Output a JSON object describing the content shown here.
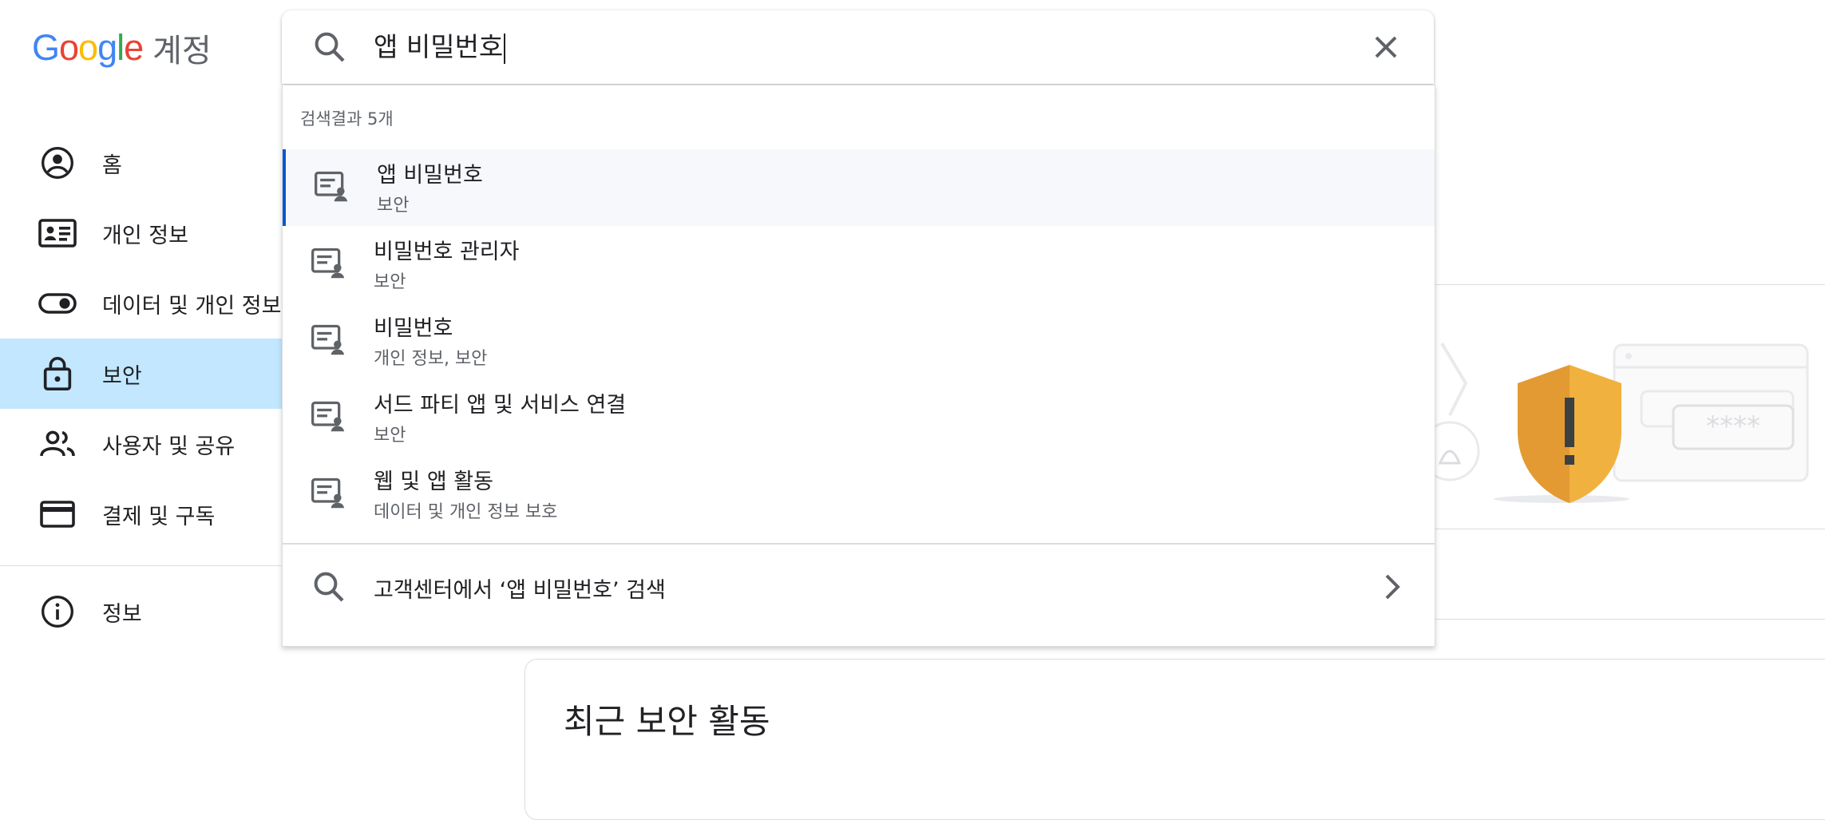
{
  "header": {
    "logo_text": "Google",
    "product_name": "계정"
  },
  "sidebar": {
    "items": [
      {
        "label": "홈",
        "icon": "account-circle-icon"
      },
      {
        "label": "개인 정보",
        "icon": "id-card-icon"
      },
      {
        "label": "데이터 및 개인 정보 보호",
        "icon": "toggle-icon"
      },
      {
        "label": "보안",
        "icon": "lock-icon",
        "active": true
      },
      {
        "label": "사용자 및 공유",
        "icon": "people-icon"
      },
      {
        "label": "결제 및 구독",
        "icon": "credit-card-icon"
      },
      {
        "label": "정보",
        "icon": "info-icon"
      }
    ]
  },
  "search": {
    "value": "앱 비밀번호",
    "result_count": "검색결과 5개",
    "results": [
      {
        "title": "앱 비밀번호",
        "subtitle": "보안",
        "icon": "setting-page-icon"
      },
      {
        "title": "비밀번호 관리자",
        "subtitle": "보안",
        "icon": "setting-page-icon"
      },
      {
        "title": "비밀번호",
        "subtitle": "개인 정보, 보안",
        "icon": "setting-page-icon"
      },
      {
        "title": "서드 파티 앱 및 서비스 연결",
        "subtitle": "보안",
        "icon": "setting-page-icon"
      },
      {
        "title": "웹 및 앱 활동",
        "subtitle": "데이터 및 개인 정보 보호",
        "icon": "setting-page-icon"
      }
    ],
    "help_center_label": "고객센터에서 ‘앱 비밀번호’ 검색"
  },
  "main": {
    "recent_activity_title": "최근 보안 활동",
    "illustration_password_mask": "****"
  },
  "colors": {
    "active_nav_bg": "#c2e7ff",
    "active_result_accent": "#0b57d0",
    "shield_left": "#e39a33",
    "shield_right": "#f0b13f",
    "google_blue": "#4285f4",
    "google_red": "#ea4335",
    "google_yellow": "#fbbc05",
    "google_green": "#34a853"
  }
}
